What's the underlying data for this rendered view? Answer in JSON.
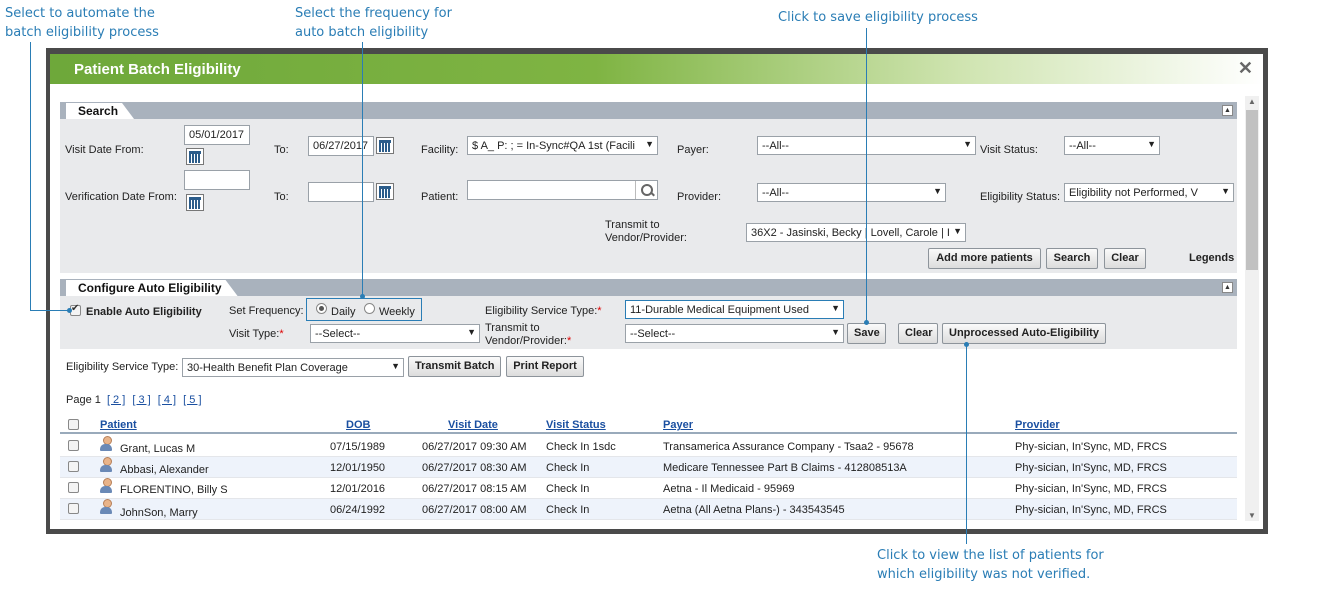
{
  "callouts": {
    "automate": "Select to automate the\nbatch eligibility process",
    "frequency": "Select the frequency for\nauto batch eligibility",
    "save": "Click to save eligibility process",
    "unprocessed": "Click to view the list of patients for\nwhich eligibility was not verified."
  },
  "modal": {
    "title": "Patient Batch Eligibility",
    "close_glyph": "✕"
  },
  "search": {
    "section_title": "Search",
    "visit_date_from_label": "Visit Date From:",
    "visit_date_from": "05/01/2017",
    "to_label": "To:",
    "visit_date_to": "06/27/2017",
    "facility_label": "Facility:",
    "facility_value": "$ A_ P: ; = In-Sync#QA 1st (Facili",
    "payer_label": "Payer:",
    "payer_value": "--All--",
    "visit_status_label": "Visit Status:",
    "visit_status_value": "--All--",
    "verification_date_from_label": "Verification Date From:",
    "verification_date_from": "",
    "verification_date_to": "",
    "patient_label": "Patient:",
    "patient_value": "",
    "provider_label": "Provider:",
    "provider_value": "--All--",
    "eligibility_status_label": "Eligibility Status:",
    "eligibility_status_value": "Eligibility not Performed, V",
    "transmit_label": "Transmit to\nVendor/Provider:",
    "transmit_value": "36X2 - Jasinski, Becky | Lovell, Carole | I",
    "add_more_patients": "Add more patients",
    "search_button": "Search",
    "clear_button": "Clear",
    "legends": "Legends"
  },
  "auto": {
    "section_title": "Configure Auto Eligibility",
    "enable_label": "Enable Auto Eligibility",
    "enable_checked": true,
    "set_frequency_label": "Set Frequency:",
    "daily_label": "Daily",
    "weekly_label": "Weekly",
    "frequency_selected": "Daily",
    "service_type_label": "Eligibility Service Type:",
    "service_type_value": "11-Durable Medical Equipment Used",
    "visit_type_label": "Visit Type:",
    "visit_type_value": "--Select--",
    "transmit_label": "Transmit to\nVendor/Provider:",
    "transmit_value": "--Select--",
    "save_button": "Save",
    "clear_button": "Clear",
    "unprocessed_button": "Unprocessed Auto-Eligibility"
  },
  "batch": {
    "service_type_label": "Eligibility Service Type:",
    "service_type_value": "30-Health Benefit Plan Coverage",
    "transmit_batch": "Transmit Batch",
    "print_report": "Print Report"
  },
  "pagination": {
    "prefix": "Page 1",
    "pages": [
      "[ 2 ]",
      "[ 3 ]",
      "[ 4 ]",
      "[ 5 ]"
    ]
  },
  "grid": {
    "columns": [
      "Patient",
      "DOB",
      "Visit Date",
      "Visit Status",
      "Payer",
      "Provider"
    ],
    "rows": [
      [
        "Grant, Lucas M",
        "07/15/1989",
        "06/27/2017 09:30 AM",
        "Check In 1sdc",
        "Transamerica Assurance Company - Tsaa2 - 95678",
        "Phy-sician, In'Sync, MD, FRCS"
      ],
      [
        "Abbasi, Alexander",
        "12/01/1950",
        "06/27/2017 08:30 AM",
        "Check In",
        "Medicare Tennessee Part B Claims - 412808513A",
        "Phy-sician, In'Sync, MD, FRCS"
      ],
      [
        "FLORENTINO, Billy S",
        "12/01/2016",
        "06/27/2017 08:15 AM",
        "Check In",
        "Aetna - Il Medicaid - 95969",
        "Phy-sician, In'Sync, MD, FRCS"
      ],
      [
        "JohnSon, Marry",
        "06/24/1992",
        "06/27/2017 08:00 AM",
        "Check In",
        "Aetna (All Aetna Plans-) - 343543545",
        "Phy-sician, In'Sync, MD, FRCS"
      ]
    ]
  }
}
